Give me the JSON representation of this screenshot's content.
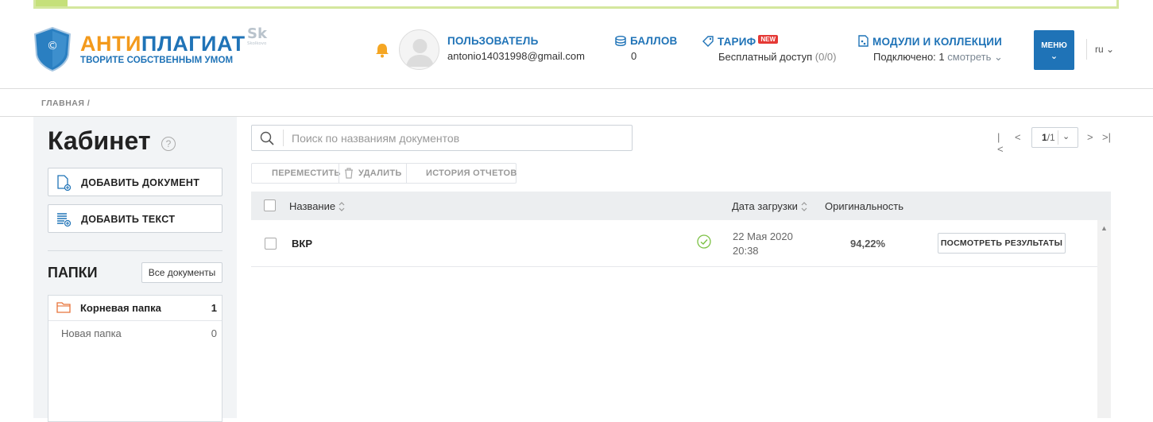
{
  "brand": {
    "title_part1": "АНТИ",
    "title_part2": "ПЛАГИАТ",
    "subtitle": "ТВОРИТЕ СОБСТВЕННЫМ УМОМ",
    "shield_symbol": "©",
    "sk_logo": "Sk",
    "sk_caption": "Skolkovo"
  },
  "header": {
    "user_label": "ПОЛЬЗОВАТЕЛЬ",
    "user_email": "antonio14031998@gmail.com",
    "balls_label": "БАЛЛОВ",
    "balls_value": "0",
    "tarif_label": "ТАРИФ",
    "tarif_badge": "NEW",
    "tarif_value": "Бесплатный доступ",
    "tarif_count": "(0/0)",
    "modules_label": "МОДУЛИ И КОЛЛЕКЦИИ",
    "modules_connected": "Подключено: 1",
    "modules_link": "смотреть",
    "menu_label": "МЕНЮ",
    "lang": "ru"
  },
  "breadcrumb": {
    "home": "ГЛАВНАЯ",
    "separator": "/"
  },
  "sidebar": {
    "title": "Кабинет",
    "help": "?",
    "add_document": "ДОБАВИТЬ ДОКУМЕНТ",
    "add_text": "ДОБАВИТЬ ТЕКСТ",
    "folders_title": "ПАПКИ",
    "all_documents": "Все документы",
    "folders": [
      {
        "name": "Корневая папка",
        "count": "1"
      },
      {
        "name": "Новая папка",
        "count": "0"
      }
    ]
  },
  "search": {
    "placeholder": "Поиск по названиям документов"
  },
  "pager": {
    "current": "1",
    "total": "/1"
  },
  "actions": {
    "move": "ПЕРЕМЕСТИТЬ",
    "delete": "УДАЛИТЬ",
    "history": "ИСТОРИЯ ОТЧЕТОВ"
  },
  "table": {
    "col_name": "Название",
    "col_date": "Дата загрузки",
    "col_originality": "Оригинальность",
    "rows": [
      {
        "name": "ВКР",
        "date": "22 Мая 2020",
        "time": "20:38",
        "originality": "94,22%",
        "action": "ПОСМОТРЕТЬ РЕЗУЛЬТАТЫ"
      }
    ]
  },
  "colors": {
    "brand_blue": "#1f73b7",
    "brand_orange": "#f39a1c",
    "status_green": "#7bc043",
    "badge_red": "#e53935"
  }
}
